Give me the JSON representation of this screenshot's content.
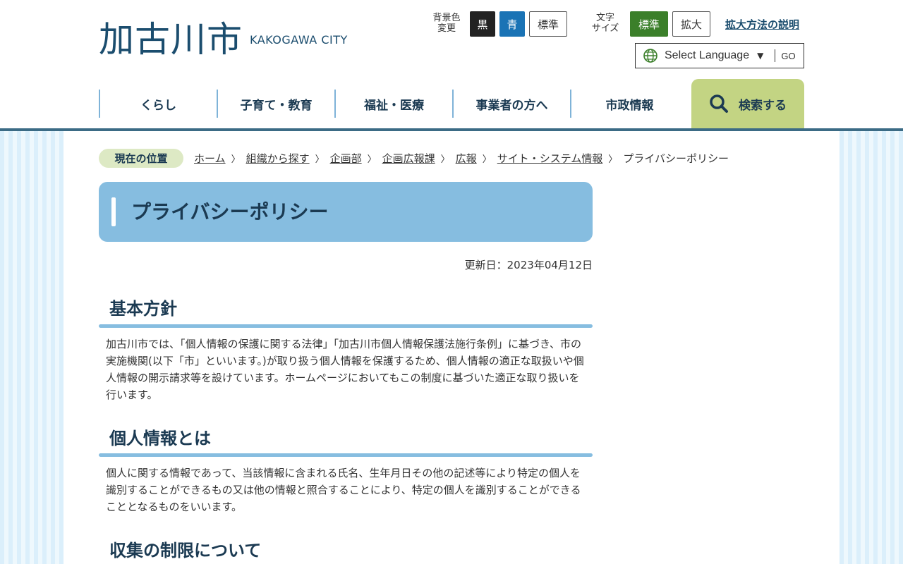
{
  "header": {
    "logo_main": "加古川市",
    "logo_sub": "KAKOGAWA CITY",
    "bg_color_label_1": "背景色",
    "bg_color_label_2": "変更",
    "bg_black": "黒",
    "bg_blue": "青",
    "bg_standard": "標準",
    "font_size_label_1": "文字",
    "font_size_label_2": "サイズ",
    "font_standard": "標準",
    "font_large": "拡大",
    "zoom_help_link": "拡大方法の説明",
    "language_select": "Select Language",
    "language_go": "GO"
  },
  "nav": {
    "items": [
      {
        "label": "くらし"
      },
      {
        "label": "子育て・教育"
      },
      {
        "label": "福祉・医療"
      },
      {
        "label": "事業者の方へ"
      },
      {
        "label": "市政情報"
      }
    ],
    "search_label": "検索する"
  },
  "breadcrumb": {
    "badge": "現在の位置",
    "items": [
      "ホーム",
      "組織から探す",
      "企画部",
      "企画広報課",
      "広報",
      "サイト・システム情報"
    ],
    "current": "プライバシーポリシー"
  },
  "page": {
    "title": "プライバシーポリシー",
    "updated": "更新日：2023年04月12日",
    "sections": [
      {
        "heading": "基本方針",
        "body": "加古川市では、「個人情報の保護に関する法律」「加古川市個人情報保護法施行条例」に基づき、市の実施機関(以下「市」といいます。)が取り扱う個人情報を保護するため、個人情報の適正な取扱いや個人情報の開示請求等を設けています。ホームページにおいてもこの制度に基づいた適正な取り扱いを行います。"
      },
      {
        "heading": "個人情報とは",
        "body": "個人に関する情報であって、当該情報に含まれる氏名、生年月日その他の記述等により特定の個人を識別することができるもの又は他の情報と照合することにより、特定の個人を識別することができることとなるものをいいます。"
      },
      {
        "heading": "収集の制限について",
        "body": ""
      }
    ]
  },
  "colors": {
    "brand": "#1b4d6e",
    "title_bg": "#86bde0",
    "search_bg": "#c3d483",
    "font_std_active": "#3b7f2a",
    "bg_blue_btn": "#1a73b5"
  }
}
